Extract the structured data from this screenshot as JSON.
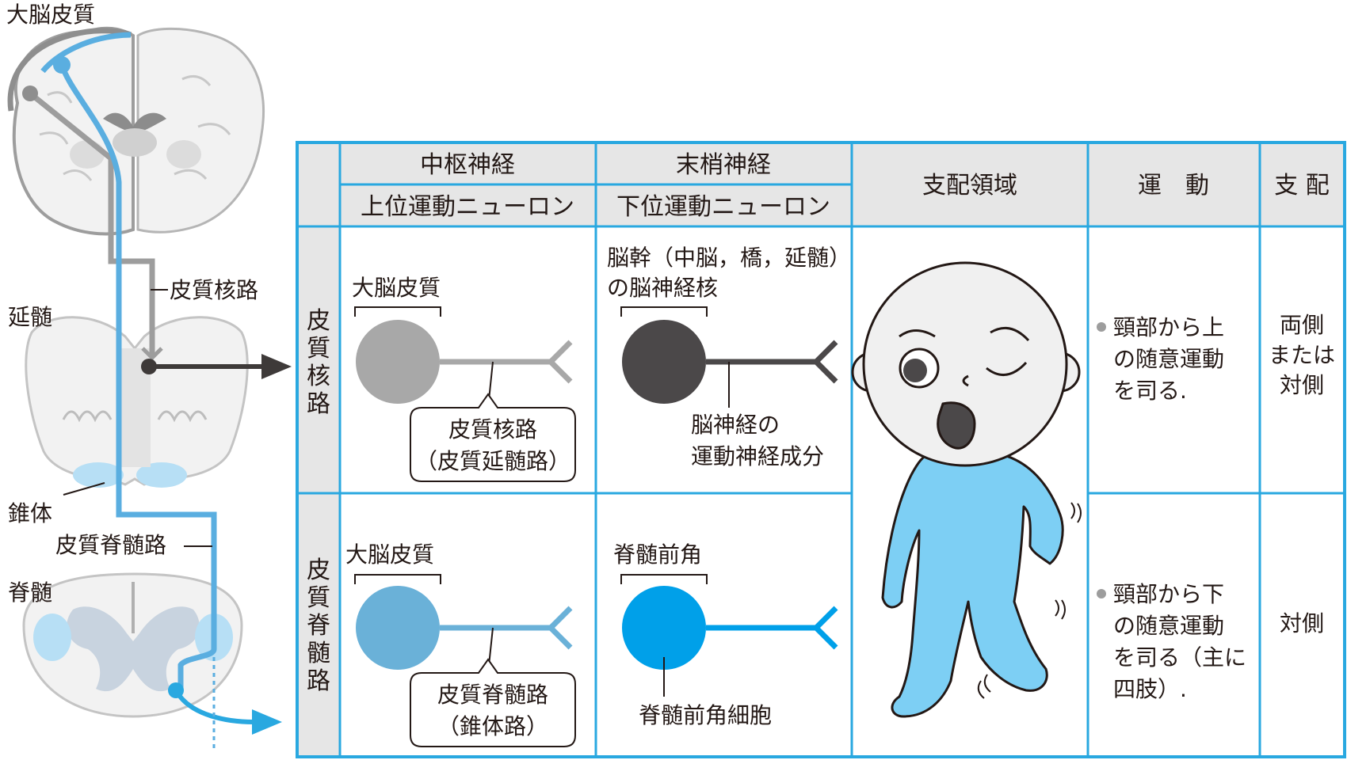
{
  "brain_labels": {
    "cerebral_cortex": "大脳皮質",
    "medulla": "延髄",
    "pyramid": "錐体",
    "spinal_cord": "脊髄",
    "corticobulbar_tract": "皮質核路",
    "corticospinal_tract": "皮質脊髄路"
  },
  "table": {
    "header": {
      "central": "中枢神経",
      "peripheral": "末梢神経",
      "upper_neuron": "上位運動ニューロン",
      "lower_neuron": "下位運動ニューロン",
      "domain": "支配領域",
      "movement": "運　動",
      "control": "支 配"
    },
    "rows": [
      {
        "name": "皮質核路",
        "upper_origin": "大脳皮質",
        "upper_tract_line1": "皮質核路",
        "upper_tract_line2": "（皮質延髄路）",
        "lower_origin_line1": "脳幹（中脳，橋，延髄）",
        "lower_origin_line2": "の脳神経核",
        "lower_note_line1": "脳神経の",
        "lower_note_line2": "運動神経成分",
        "movement_lines": [
          "頸部から上",
          "の随意運動",
          "を司る."
        ],
        "control_lines": [
          "両側",
          "または",
          "対側"
        ]
      },
      {
        "name": "皮質脊髄路",
        "upper_origin": "大脳皮質",
        "upper_tract_line1": "皮質脊髄路",
        "upper_tract_line2": "（錐体路）",
        "lower_origin_line1": "脊髄前角",
        "lower_note_line1": "脊髄前角細胞",
        "movement_lines": [
          "頸部から下",
          "の随意運動",
          "を司る（主に",
          "四肢）."
        ],
        "control_lines": [
          "対側"
        ]
      }
    ]
  },
  "colors": {
    "frame_blue": "#29a8e0",
    "tract_blue": "#5aaee0",
    "tract_gray": "#9d9d9d",
    "header_fill": "#e6e6e6",
    "upper_gray_cell": "#a8a8a8",
    "lower_dark_cell": "#4b4849",
    "upper_blue_cell": "#6ab1d8",
    "lower_blue_cell": "#00a0e9",
    "body_blue": "#7dcff4"
  }
}
